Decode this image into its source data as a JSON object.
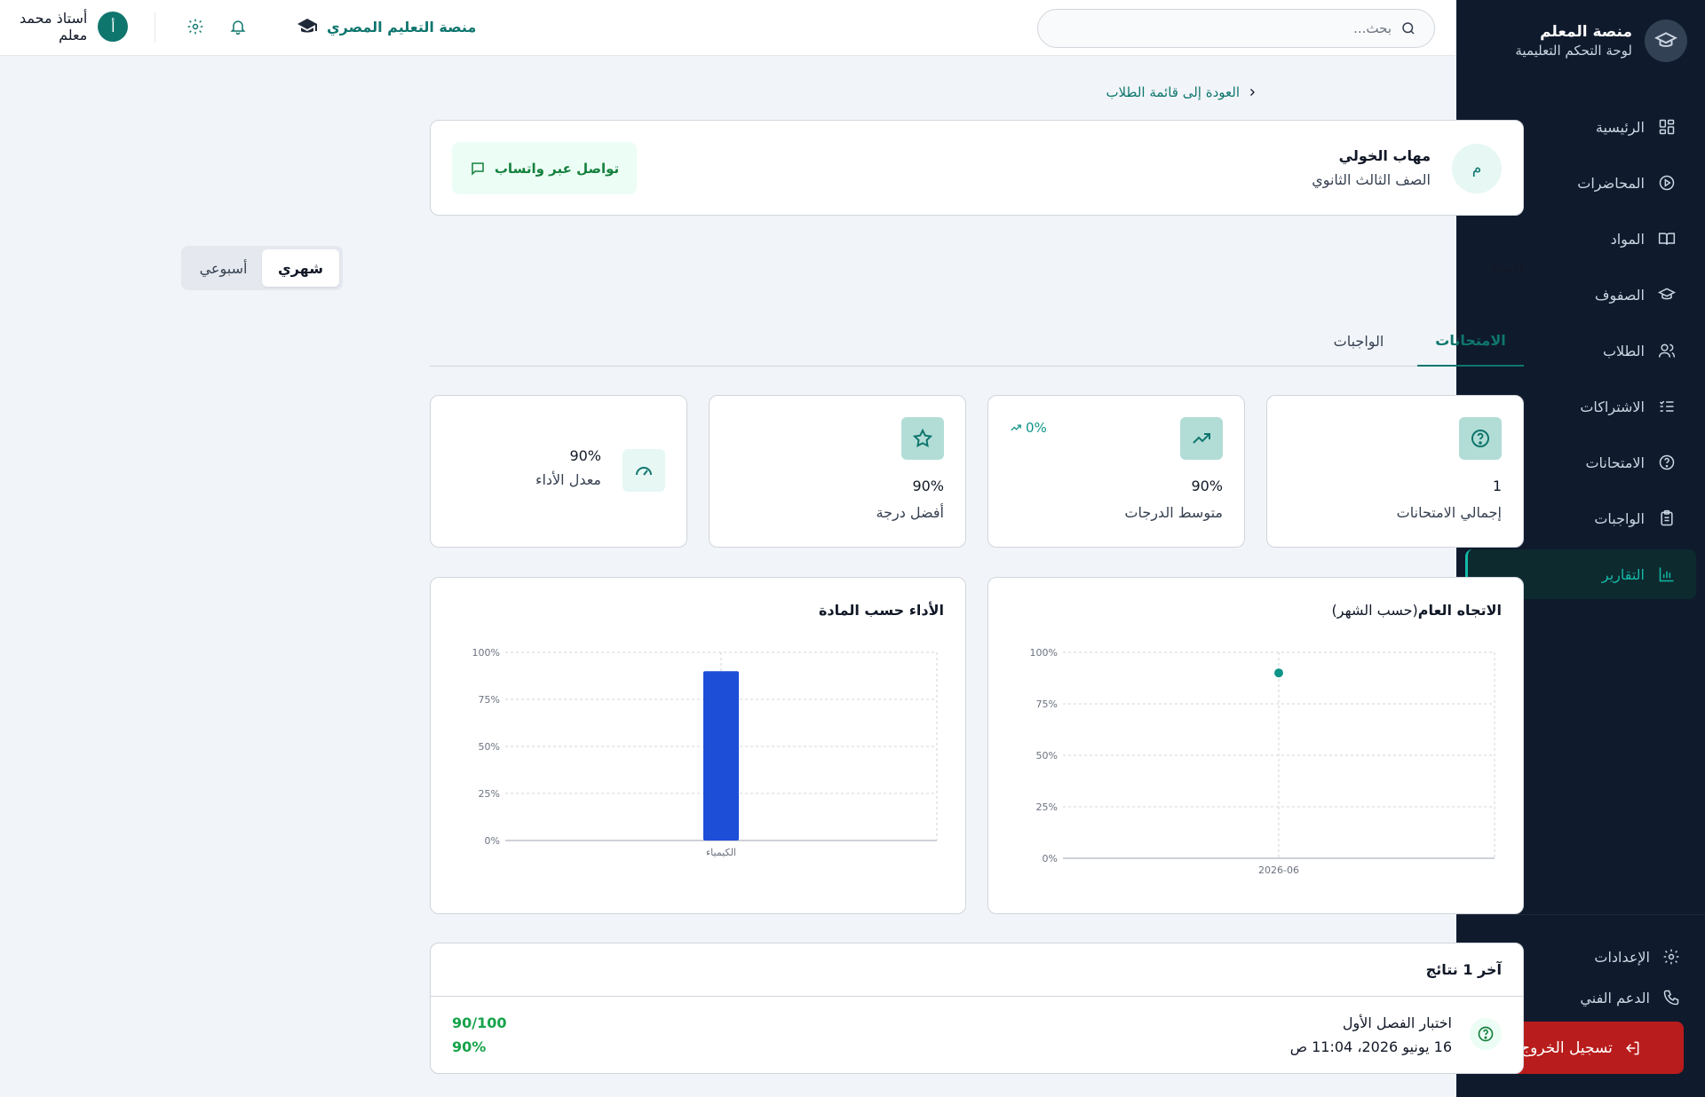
{
  "sidebar": {
    "brand_title": "منصة المعلم",
    "brand_subtitle": "لوحة التحكم التعليمية",
    "items": [
      {
        "label": "الرئيسية",
        "icon": "dashboard-icon"
      },
      {
        "label": "المحاضرات",
        "icon": "play-circle-icon"
      },
      {
        "label": "المواد",
        "icon": "book-icon"
      },
      {
        "label": "الصفوف",
        "icon": "graduation-cap-icon"
      },
      {
        "label": "الطلاب",
        "icon": "users-icon"
      },
      {
        "label": "الاشتراكات",
        "icon": "list-check-icon"
      },
      {
        "label": "الامتحانات",
        "icon": "help-circle-icon"
      },
      {
        "label": "الواجبات",
        "icon": "clipboard-icon"
      },
      {
        "label": "التقارير",
        "icon": "bar-chart-icon",
        "active": true
      }
    ],
    "settings_label": "الإعدادات",
    "support_label": "الدعم الفني",
    "logout_label": "تسجيل الخروج"
  },
  "topbar": {
    "search_placeholder": "بحث...",
    "platform_name": "منصة التعليم المصري",
    "user_name": "أستاذ محمد",
    "user_role": "معلم",
    "user_initial": "أ"
  },
  "breadcrumb": {
    "back_label": "العودة إلى قائمة الطلاب"
  },
  "student": {
    "initial": "م",
    "name": "مهاب الخولي",
    "grade": "الصف الثالث الثانوي",
    "whatsapp_label": "تواصل عبر واتساب"
  },
  "reports": {
    "title": "التقارير",
    "period_options": [
      "شهري",
      "أسبوعي"
    ],
    "selected_period": "شهري",
    "tabs": [
      "الامتحانات",
      "الواجبات"
    ],
    "active_tab": "الامتحانات"
  },
  "stats": {
    "total_exams": {
      "value": "1",
      "label": "إجمالي الامتحانات"
    },
    "avg_score": {
      "value": "90%",
      "label": "متوسط الدرجات",
      "trend": "0%"
    },
    "best_score": {
      "value": "90%",
      "label": "أفضل درجة"
    },
    "performance": {
      "value": "90%",
      "label": "معدل الأداء"
    }
  },
  "charts": {
    "trend_title": "الاتجاه العام",
    "trend_subtitle": "(حسب الشهر)",
    "subject_title": "الأداء حسب المادة"
  },
  "chart_data": [
    {
      "type": "scatter",
      "title": "الاتجاه العام(حسب الشهر)",
      "x": [
        "2026-06"
      ],
      "y": [
        90
      ],
      "ylim": [
        0,
        100
      ],
      "yticks": [
        "0%",
        "25%",
        "50%",
        "75%",
        "100%"
      ],
      "grid": true,
      "color": "#0f9488"
    },
    {
      "type": "bar",
      "title": "الأداء حسب المادة",
      "categories": [
        "الكيمياء"
      ],
      "values": [
        90
      ],
      "ylim": [
        0,
        100
      ],
      "yticks": [
        "0%",
        "25%",
        "50%",
        "75%",
        "100%"
      ],
      "grid": true,
      "color": "#1d4ed8"
    }
  ],
  "results": {
    "header": "آخر 1 نتائج",
    "items": [
      {
        "name": "اختبار الفصل الأول",
        "date": "16 يونيو 2026، 11:04 ص",
        "score": "90/100",
        "percent": "90%"
      }
    ]
  },
  "colors": {
    "accent": "#0f766e",
    "sidebar_bg": "#0f1b2d",
    "logout": "#b91c1c",
    "bar": "#1d4ed8",
    "success": "#16a34a"
  }
}
